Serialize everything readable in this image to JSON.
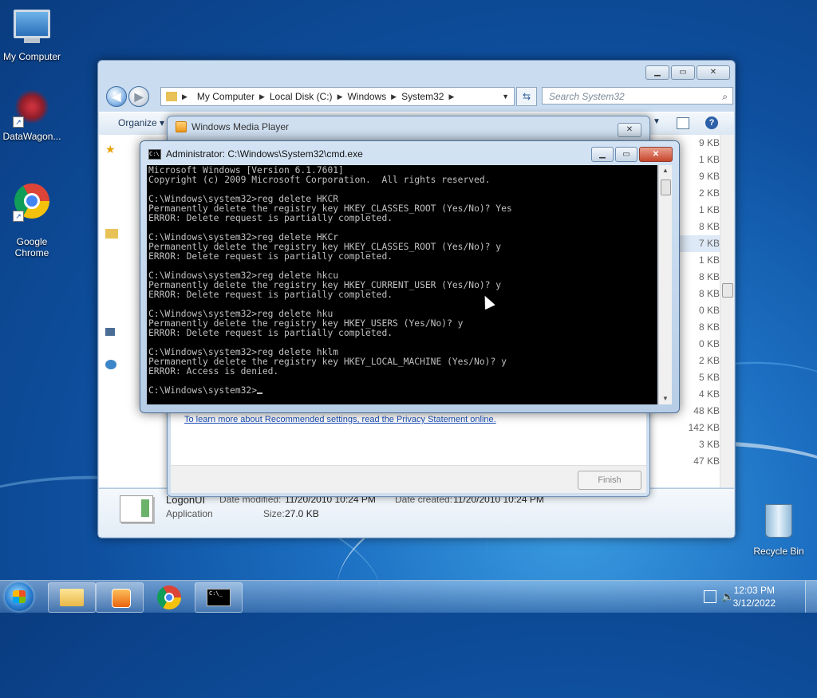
{
  "desktop": {
    "icons": [
      {
        "label": "My Computer"
      },
      {
        "label": "DataWagon..."
      },
      {
        "label": "Google\nChrome"
      },
      {
        "label": "Recycle Bin"
      }
    ]
  },
  "explorer": {
    "breadcrumb": [
      "My Computer",
      "Local Disk (C:)",
      "Windows",
      "System32"
    ],
    "search_placeholder": "Search System32",
    "organize_label": "Organize",
    "sizes": [
      "9 KB",
      "1 KB",
      "9 KB",
      "2 KB",
      "1 KB",
      "8 KB",
      "7 KB",
      "1 KB",
      "8 KB",
      "8 KB",
      "0 KB",
      "8 KB",
      "0 KB",
      "2 KB",
      "5 KB",
      "4 KB",
      "48 KB",
      "142 KB",
      "3 KB",
      "47 KB"
    ],
    "details": {
      "name": "LogonUI",
      "type": "Application",
      "modified_label": "Date modified:",
      "modified_value": "11/20/2010 10:24 PM",
      "created_label": "Date created:",
      "created_value": "11/20/2010 10:24 PM",
      "size_label": "Size:",
      "size_value": "27.0 KB"
    }
  },
  "wmp": {
    "title": "Windows Media Player",
    "privacy_link": "To learn more about Recommended settings, read the Privacy Statement online.",
    "finish_label": "Finish"
  },
  "cmd": {
    "title": "Administrator: C:\\Windows\\System32\\cmd.exe",
    "icon_text": "C:\\",
    "output": "Microsoft Windows [Version 6.1.7601]\nCopyright (c) 2009 Microsoft Corporation.  All rights reserved.\n\nC:\\Windows\\system32>reg delete HKCR\nPermanently delete the registry key HKEY_CLASSES_ROOT (Yes/No)? Yes\nERROR: Delete request is partially completed.\n\nC:\\Windows\\system32>reg delete HKCr\nPermanently delete the registry key HKEY_CLASSES_ROOT (Yes/No)? y\nERROR: Delete request is partially completed.\n\nC:\\Windows\\system32>reg delete hkcu\nPermanently delete the registry key HKEY_CURRENT_USER (Yes/No)? y\nERROR: Delete request is partially completed.\n\nC:\\Windows\\system32>reg delete hku\nPermanently delete the registry key HKEY_USERS (Yes/No)? y\nERROR: Delete request is partially completed.\n\nC:\\Windows\\system32>reg delete hklm\nPermanently delete the registry key HKEY_LOCAL_MACHINE (Yes/No)? y\nERROR: Access is denied.\n\nC:\\Windows\\system32>"
  },
  "taskbar": {
    "time": "12:03 PM",
    "date": "3/12/2022",
    "cmd_icon_text": "C:\\_"
  },
  "icons": [
    "computer-icon",
    "datawagon-icon",
    "chrome-icon",
    "recycle-bin-icon",
    "start-orb-icon",
    "folder-icon",
    "media-player-icon",
    "cmd-icon",
    "network-icon",
    "volume-icon",
    "search-icon",
    "refresh-icon",
    "help-icon"
  ]
}
